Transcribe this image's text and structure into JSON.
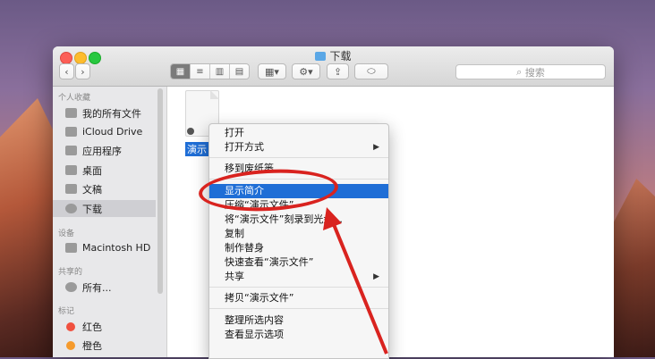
{
  "window": {
    "title": "下载"
  },
  "toolbar": {
    "back": "‹",
    "forward": "›",
    "search_placeholder": "搜索"
  },
  "sidebar": {
    "favorites_heading": "个人收藏",
    "favorites": [
      "我的所有文件",
      "iCloud Drive",
      "应用程序",
      "桌面",
      "文稿",
      "下载"
    ],
    "devices_heading": "设备",
    "devices": [
      "Macintosh HD"
    ],
    "shared_heading": "共享的",
    "shared": [
      "所有..."
    ],
    "tags_heading": "标记",
    "tags": [
      {
        "label": "红色",
        "color": "#f0503f"
      },
      {
        "label": "橙色",
        "color": "#f59a2c"
      }
    ]
  },
  "file": {
    "label": "演示"
  },
  "context_menu": {
    "items": [
      "打开",
      "打开方式",
      "移到废纸篓",
      "显示简介",
      "压缩“演示文件”",
      "将“演示文件”刻录到光盘...",
      "复制",
      "制作替身",
      "快速查看“演示文件”",
      "共享",
      "拷贝“演示文件”",
      "整理所选内容",
      "查看显示选项"
    ],
    "submenu_arrow": "▶"
  },
  "colors": {
    "highlight": "#1f6ed6",
    "annotation": "#d9231f"
  }
}
